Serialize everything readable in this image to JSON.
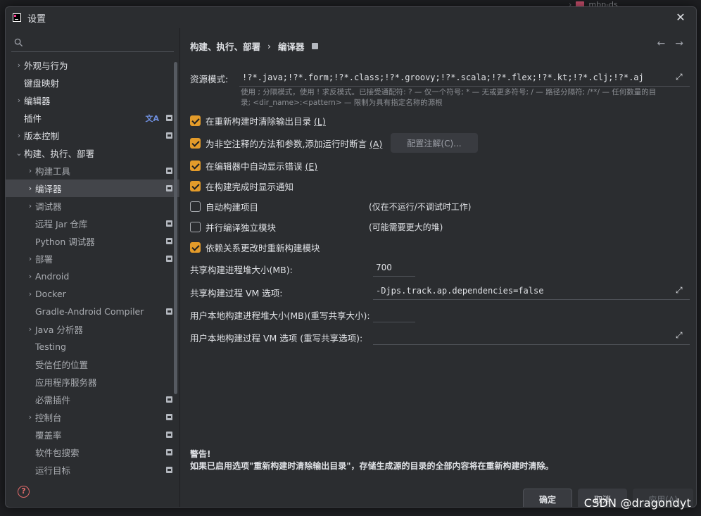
{
  "background": {
    "tree_item": "mbp-ds"
  },
  "dialog": {
    "title": "设置"
  },
  "sidebar": {
    "items": [
      {
        "label": "外观与行为",
        "chevron": "›",
        "indent": 0,
        "badge": false,
        "muted": false
      },
      {
        "label": "键盘映射",
        "chevron": "",
        "indent": 0,
        "badge": false,
        "muted": false
      },
      {
        "label": "编辑器",
        "chevron": "›",
        "indent": 0,
        "badge": false,
        "muted": false
      },
      {
        "label": "插件",
        "chevron": "",
        "indent": 0,
        "badge": true,
        "translate": "文A",
        "muted": false
      },
      {
        "label": "版本控制",
        "chevron": "›",
        "indent": 0,
        "badge": true,
        "muted": false
      },
      {
        "label": "构建、执行、部署",
        "chevron": "⌄",
        "indent": 0,
        "badge": false,
        "muted": false
      },
      {
        "label": "构建工具",
        "chevron": "›",
        "indent": 1,
        "badge": true,
        "muted": true
      },
      {
        "label": "编译器",
        "chevron": "›",
        "indent": 1,
        "badge": true,
        "selected": true,
        "muted": false
      },
      {
        "label": "调试器",
        "chevron": "›",
        "indent": 1,
        "badge": false,
        "muted": true
      },
      {
        "label": "远程 Jar 仓库",
        "chevron": "",
        "indent": 1,
        "badge": true,
        "muted": true
      },
      {
        "label": "Python 调试器",
        "chevron": "",
        "indent": 1,
        "badge": true,
        "muted": true
      },
      {
        "label": "部署",
        "chevron": "›",
        "indent": 1,
        "badge": true,
        "muted": true
      },
      {
        "label": "Android",
        "chevron": "›",
        "indent": 1,
        "badge": false,
        "muted": true
      },
      {
        "label": "Docker",
        "chevron": "›",
        "indent": 1,
        "badge": false,
        "muted": true
      },
      {
        "label": "Gradle-Android Compiler",
        "chevron": "",
        "indent": 1,
        "badge": true,
        "muted": true
      },
      {
        "label": "Java 分析器",
        "chevron": "›",
        "indent": 1,
        "badge": false,
        "muted": true
      },
      {
        "label": "Testing",
        "chevron": "",
        "indent": 1,
        "badge": false,
        "muted": true
      },
      {
        "label": "受信任的位置",
        "chevron": "",
        "indent": 1,
        "badge": false,
        "muted": true
      },
      {
        "label": "应用程序服务器",
        "chevron": "",
        "indent": 1,
        "badge": false,
        "muted": true
      },
      {
        "label": "必需插件",
        "chevron": "",
        "indent": 1,
        "badge": true,
        "muted": true
      },
      {
        "label": "控制台",
        "chevron": "›",
        "indent": 1,
        "badge": true,
        "muted": true
      },
      {
        "label": "覆盖率",
        "chevron": "",
        "indent": 1,
        "badge": true,
        "muted": true
      },
      {
        "label": "软件包搜索",
        "chevron": "",
        "indent": 1,
        "badge": true,
        "muted": true
      },
      {
        "label": "运行目标",
        "chevron": "",
        "indent": 1,
        "badge": true,
        "muted": true
      }
    ]
  },
  "breadcrumb": {
    "parent": "构建、执行、部署",
    "separator": "›",
    "current": "编译器"
  },
  "resource_patterns": {
    "label": "资源模式:",
    "value": "!?*.java;!?*.form;!?*.class;!?*.groovy;!?*.scala;!?*.flex;!?*.kt;!?*.clj;!?*.aj",
    "hint_line1": "使用 ; 分隔模式，使用 ! 求反模式。已接受通配符: ? — 仅一个符号; * — 无或更多符号; / — 路径分隔符; /**/ — 任何数量的目",
    "hint_line2": "录; <dir_name>:<pattern> — 限制为具有指定名称的源根"
  },
  "options": {
    "clear_output": {
      "label": "在重新构建时清除输出目录 ",
      "shortcut": "(L)",
      "checked": true
    },
    "add_assertions": {
      "label": "为非空注释的方法和参数,添加运行时断言 ",
      "shortcut": "(A)",
      "checked": true
    },
    "configure_annotations": "配置注解(C)...",
    "show_errors": {
      "label": "在编辑器中自动显示错误 ",
      "shortcut": "(E)",
      "checked": true
    },
    "notify_done": {
      "label": "在构建完成时显示通知",
      "checked": true
    },
    "auto_build": {
      "label": "自动构建项目",
      "checked": false,
      "note": "(仅在不运行/不调试时工作)"
    },
    "parallel": {
      "label": "并行编译独立模块",
      "checked": false,
      "note": "(可能需要更大的堆)"
    },
    "rebuild_deps": {
      "label": "依赖关系更改时重新构建模块",
      "checked": true
    }
  },
  "shared_heap": {
    "label": "共享构建进程堆大小(MB):",
    "value": "700"
  },
  "shared_vm": {
    "label": "共享构建过程 VM 选项:",
    "value": "-Djps.track.ap.dependencies=false"
  },
  "user_heap": {
    "label": "用户本地构建进程堆大小(MB)(重写共享大小):",
    "value": ""
  },
  "user_vm": {
    "label": "用户本地构建过程 VM 选项 (重写共享选项):",
    "value": ""
  },
  "warning": {
    "title": "警告!",
    "body": "如果已启用选项\"重新构建时清除输出目录\"，存储生成源的目录的全部内容将在重新构建时清除。"
  },
  "buttons": {
    "ok": "确定",
    "cancel": "取消",
    "apply": "应用(A)"
  },
  "watermark": "CSDN @dragondyt",
  "colors": {
    "accent_checkbox": "#e39b2a",
    "dialog_bg": "#2b2d30",
    "selection": "#43454a"
  }
}
